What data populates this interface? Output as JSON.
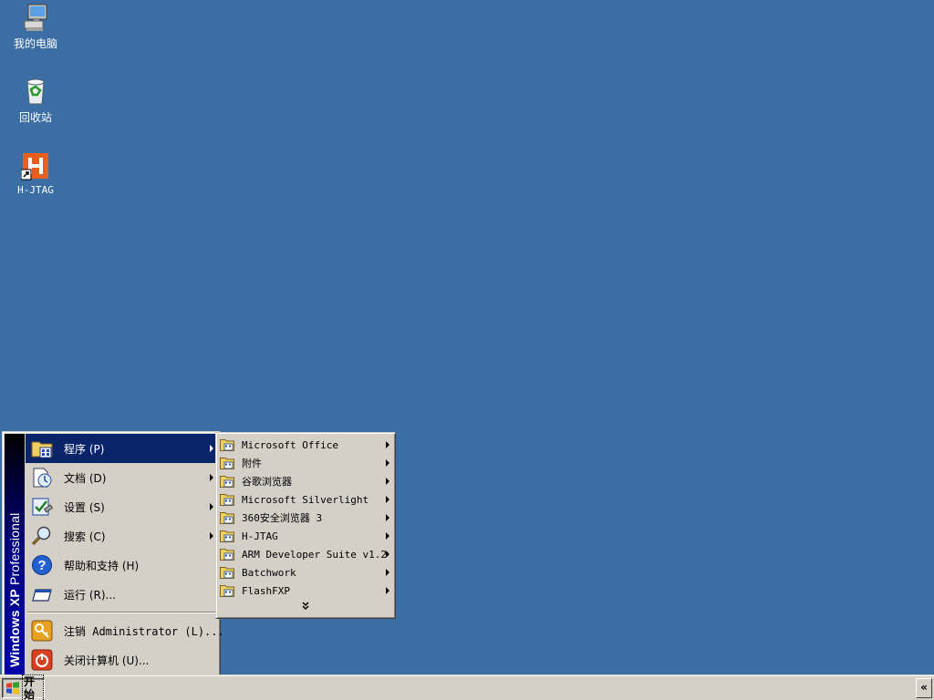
{
  "desktop": {
    "background_color": "#3a6ea5",
    "icons": [
      {
        "label": "我的电脑",
        "icon": "my-computer-icon"
      },
      {
        "label": "回收站",
        "icon": "recycle-bin-icon"
      },
      {
        "label": "H-JTAG",
        "icon": "h-jtag-shortcut-icon"
      }
    ]
  },
  "start_menu": {
    "banner": {
      "brand_bold": "Windows XP",
      "brand_edition": "Professional",
      "colors": [
        "#000000",
        "#0000a8"
      ]
    },
    "items": [
      {
        "label": "程序 (P)",
        "icon": "programs-icon",
        "has_submenu": true,
        "highlighted": true
      },
      {
        "label": "文档 (D)",
        "icon": "documents-icon",
        "has_submenu": true
      },
      {
        "label": "设置 (S)",
        "icon": "settings-icon",
        "has_submenu": true
      },
      {
        "label": "搜索 (C)",
        "icon": "search-icon",
        "has_submenu": true
      },
      {
        "label": "帮助和支持 (H)",
        "icon": "help-icon",
        "has_submenu": false
      },
      {
        "label": "运行 (R)...",
        "icon": "run-icon",
        "has_submenu": false
      }
    ],
    "bottom_items": [
      {
        "label": "注销 Administrator (L)...",
        "icon": "logoff-icon"
      },
      {
        "label": "关闭计算机 (U)...",
        "icon": "shutdown-icon"
      }
    ],
    "highlight_color": "#0a246a"
  },
  "programs_submenu": {
    "items": [
      {
        "label": "Microsoft Office",
        "icon": "program-group-icon"
      },
      {
        "label": "附件",
        "icon": "program-group-icon"
      },
      {
        "label": "谷歌浏览器",
        "icon": "program-group-icon"
      },
      {
        "label": "Microsoft Silverlight",
        "icon": "program-group-icon"
      },
      {
        "label": "360安全浏览器 3",
        "icon": "program-group-icon"
      },
      {
        "label": "H-JTAG",
        "icon": "program-group-icon"
      },
      {
        "label": "ARM Developer Suite v1.2",
        "icon": "program-group-icon"
      },
      {
        "label": "Batchwork",
        "icon": "program-group-icon"
      },
      {
        "label": "FlashFXP",
        "icon": "program-group-icon"
      }
    ],
    "expand_glyph": "»"
  },
  "taskbar": {
    "start_label": "开始",
    "tray_toggle_glyph": "«",
    "face_color": "#d4d0c8"
  }
}
